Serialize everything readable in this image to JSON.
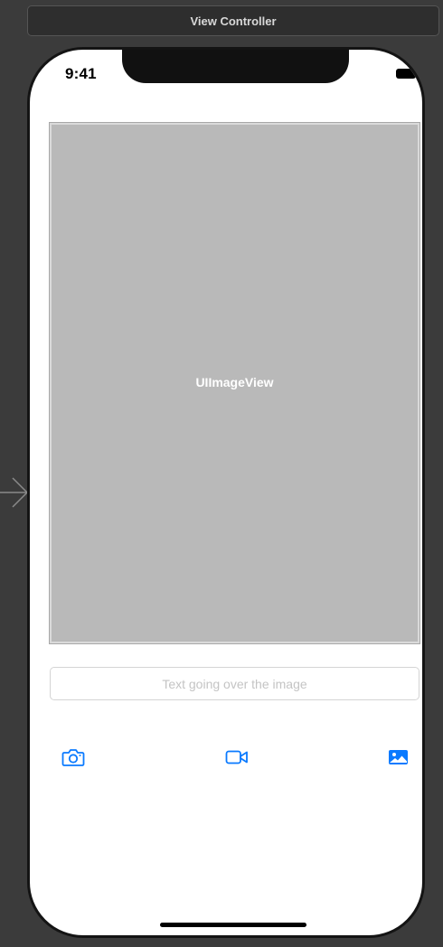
{
  "scene": {
    "title": "View Controller"
  },
  "status_bar": {
    "time": "9:41",
    "battery_icon": "battery-icon"
  },
  "image_view": {
    "label": "UIImageView"
  },
  "text_field": {
    "placeholder": "Text going over the image",
    "value": ""
  },
  "toolbar": {
    "buttons": [
      {
        "icon": "camera-icon"
      },
      {
        "icon": "video-icon"
      },
      {
        "icon": "photo-icon"
      }
    ]
  },
  "colors": {
    "accent": "#0a7aff",
    "image_placeholder": "#b9b9b9",
    "canvas_background": "#3b3b3b"
  }
}
